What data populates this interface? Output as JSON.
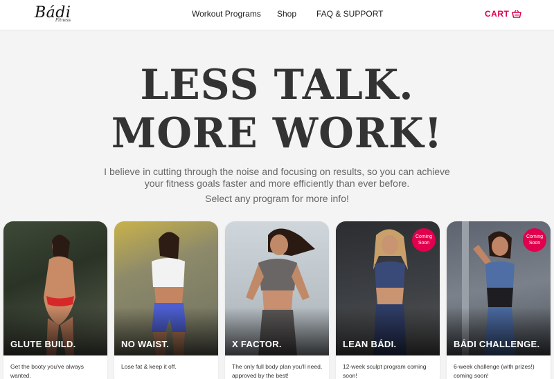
{
  "header": {
    "logo_text": "Bádi",
    "logo_sub": "Fitness",
    "nav": [
      "Workout Programs",
      "Shop",
      "FAQ & SUPPORT"
    ],
    "cart_label": "CART",
    "cart_icon": "basket-icon"
  },
  "hero": {
    "line1": "LESS TALK.",
    "line2": "MORE WORK!",
    "description": "I believe in cutting through the noise and focusing on results, so you can achieve your fitness goals faster and more efficiently than ever before.",
    "select_prompt": "Select any program for more info!"
  },
  "colors": {
    "accent": "#e0004d",
    "background": "#f4f4f4",
    "heading": "#333333"
  },
  "programs": [
    {
      "title": "GLUTE BUILD.",
      "description": "Get the booty you've always wanted.",
      "badge": ""
    },
    {
      "title": "NO WAIST.",
      "description": "Lose fat & keep it off.",
      "badge": ""
    },
    {
      "title": "X FACTOR.",
      "description": "The only full body plan you'll need, approved by the best!",
      "badge": ""
    },
    {
      "title": "LEAN BÁDI.",
      "description": "12-week sculpt program coming soon!",
      "badge": "Coming Soon"
    },
    {
      "title": "BÁDI CHALLENGE.",
      "description": "6-week challenge (with prizes!) coming soon!",
      "badge": "Coming Soon"
    }
  ]
}
